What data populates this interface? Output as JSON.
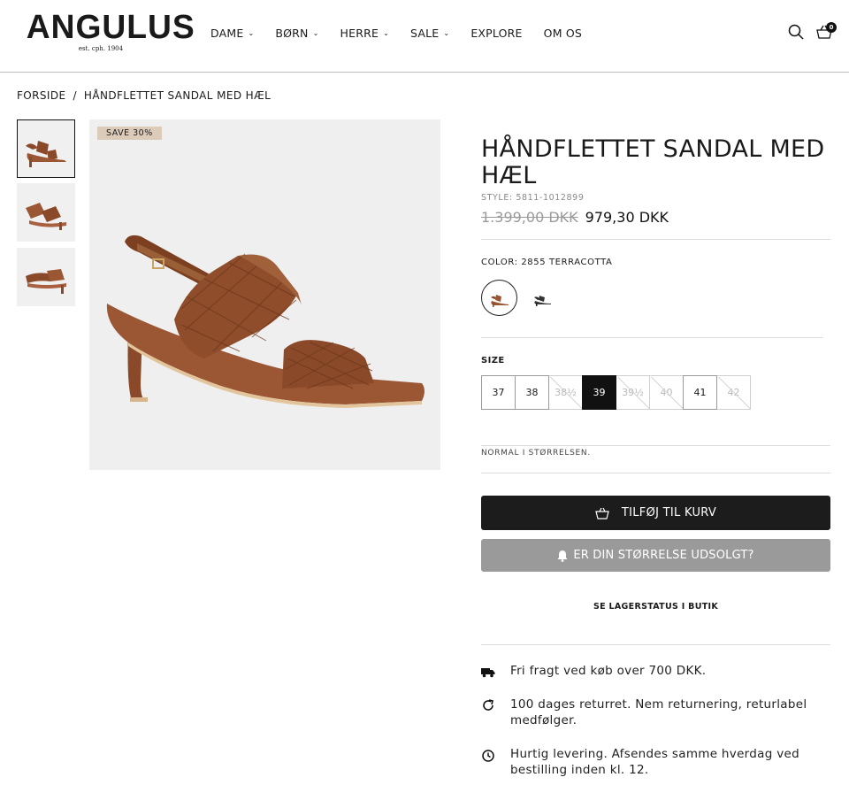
{
  "brand": {
    "name": "ANGULUS",
    "tagline": "est. cph. 1904"
  },
  "nav": [
    {
      "label": "DAME",
      "has_dropdown": true
    },
    {
      "label": "BØRN",
      "has_dropdown": true
    },
    {
      "label": "HERRE",
      "has_dropdown": true
    },
    {
      "label": "SALE",
      "has_dropdown": true
    },
    {
      "label": "EXPLORE",
      "has_dropdown": false
    },
    {
      "label": "OM OS",
      "has_dropdown": false
    }
  ],
  "cart": {
    "count": "0"
  },
  "breadcrumb": {
    "home": "FORSIDE",
    "separator": "/",
    "current": "HÅNDFLETTET SANDAL MED HÆL"
  },
  "badge": {
    "label": "SAVE 30%"
  },
  "product": {
    "title": "HÅNDFLETTET SANDAL MED HÆL",
    "style": "STYLE: 5811-1012899",
    "price_old": "1.399,00 DKK",
    "price_new": "979,30 DKK",
    "color_label": "COLOR: 2855 TERRACOTTA",
    "size_label": "SIZE",
    "size_note": "NORMAL I STØRRELSEN.",
    "sizes": [
      {
        "label": "37",
        "status": "available"
      },
      {
        "label": "38",
        "status": "available"
      },
      {
        "label": "38½",
        "status": "sold_out"
      },
      {
        "label": "39",
        "status": "selected"
      },
      {
        "label": "39½",
        "status": "sold_out"
      },
      {
        "label": "40",
        "status": "sold_out"
      },
      {
        "label": "41",
        "status": "available"
      },
      {
        "label": "42",
        "status": "sold_out"
      }
    ],
    "accent_color": "#8a4a2a"
  },
  "actions": {
    "add_to_cart": "TILFØJ TIL KURV",
    "sold_out_notify": "ER DIN STØRRELSE UDSOLGT?",
    "stock_status": "SE LAGERSTATUS I BUTIK"
  },
  "usps": [
    {
      "icon": "truck-icon",
      "text": "Fri fragt ved køb over 700 DKK."
    },
    {
      "icon": "return-icon",
      "text": "100 dages returret. Nem returnering, returlabel medfølger."
    },
    {
      "icon": "clock-icon",
      "text": "Hurtig levering. Afsendes samme hverdag ved bestilling inden kl. 12."
    }
  ]
}
